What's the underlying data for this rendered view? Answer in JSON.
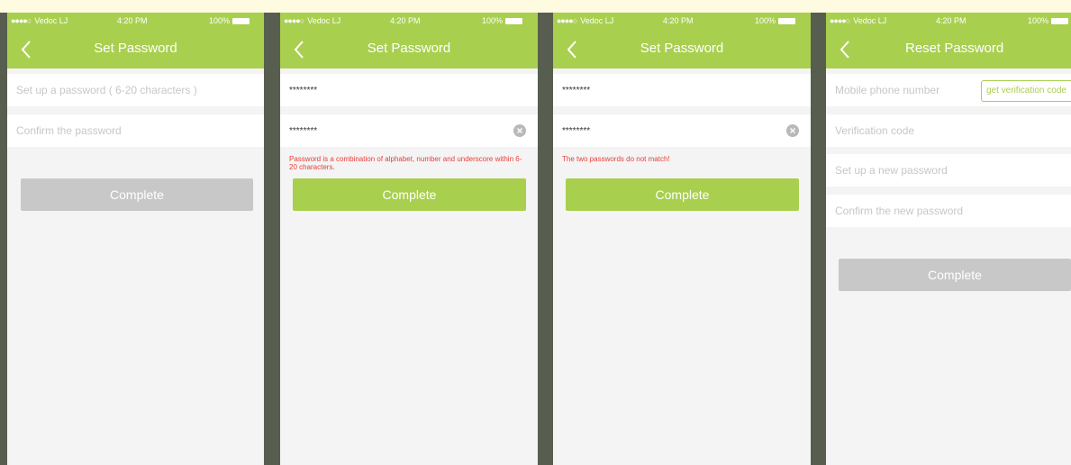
{
  "colors": {
    "accent": "#a9cf4f",
    "error": "#e8403b",
    "disabled": "#c8c8c8",
    "background": "#f4f4f4"
  },
  "status_bar": {
    "carrier": "Vedoc LJ",
    "time": "4:20 PM",
    "battery": "100%"
  },
  "screens": [
    {
      "title": "Set Password",
      "password_placeholder": "Set up a password ( 6-20 characters )",
      "confirm_placeholder": "Confirm the password",
      "button": "Complete"
    },
    {
      "title": "Set Password",
      "password_value": "********",
      "confirm_value": "********",
      "error": "Password is a combination of alphabet, number and underscore within 6-20 characters.",
      "button": "Complete"
    },
    {
      "title": "Set Password",
      "password_value": "********",
      "confirm_value": "********",
      "error": "The two passwords do not match!",
      "button": "Complete"
    },
    {
      "title": "Reset Password",
      "phone_placeholder": "Mobile phone number",
      "code_button": "get verification code",
      "code_placeholder": "Verification code",
      "new_password_placeholder": "Set up a new password",
      "confirm_placeholder": "Confirm the new password",
      "button": "Complete"
    }
  ]
}
